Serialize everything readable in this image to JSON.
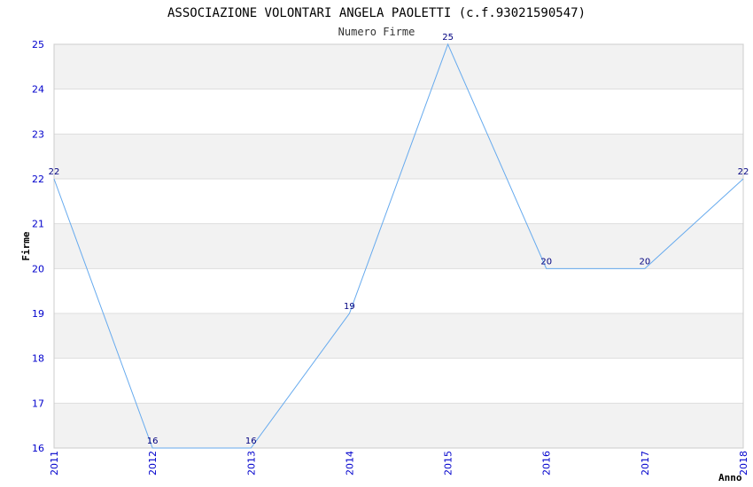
{
  "chart_data": {
    "type": "line",
    "title": "ASSOCIAZIONE VOLONTARI ANGELA PAOLETTI (c.f.93021590547)",
    "subtitle": "Numero Firme",
    "xlabel": "Anno",
    "ylabel": "Firme",
    "categories": [
      "2011",
      "2012",
      "2013",
      "2014",
      "2015",
      "2016",
      "2017",
      "2018"
    ],
    "values": [
      22,
      16,
      16,
      19,
      25,
      20,
      20,
      22
    ],
    "ylim": [
      16,
      25
    ],
    "yticks": [
      "16",
      "17",
      "18",
      "19",
      "20",
      "21",
      "22",
      "23",
      "24",
      "25"
    ],
    "grid": true,
    "colors": {
      "line": "#66aaee",
      "tick_text": "#0000cc",
      "data_label": "#000080",
      "band": "#f2f2f2",
      "gridline": "#dddddd"
    }
  }
}
